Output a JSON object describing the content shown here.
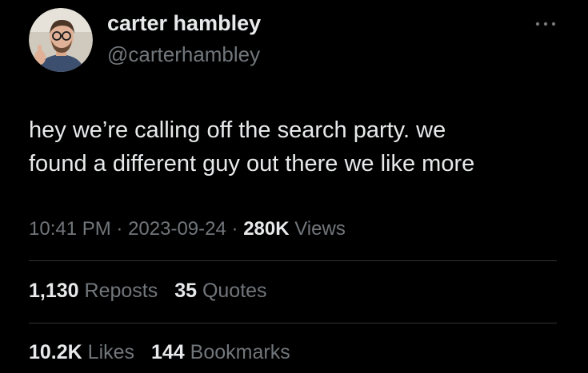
{
  "user": {
    "display_name": "carter hambley",
    "handle": "@carterhambley"
  },
  "tweet": {
    "line1": "hey we’re calling off the search party. we",
    "line2": "found a different guy out there we like more"
  },
  "meta": {
    "time": "10:41 PM",
    "separator": "·",
    "date": "2023-09-24",
    "views_count": "280K",
    "views_label": "Views"
  },
  "stats": {
    "reposts_count": "1,130",
    "reposts_label": "Reposts",
    "quotes_count": "35",
    "quotes_label": "Quotes",
    "likes_count": "10.2K",
    "likes_label": "Likes",
    "bookmarks_count": "144",
    "bookmarks_label": "Bookmarks"
  },
  "icons": {
    "more": "more-horizontal-icon"
  },
  "colors": {
    "background": "#000000",
    "primary_text": "#e7e9ea",
    "secondary_text": "#71767b",
    "divider": "#2f3336"
  }
}
